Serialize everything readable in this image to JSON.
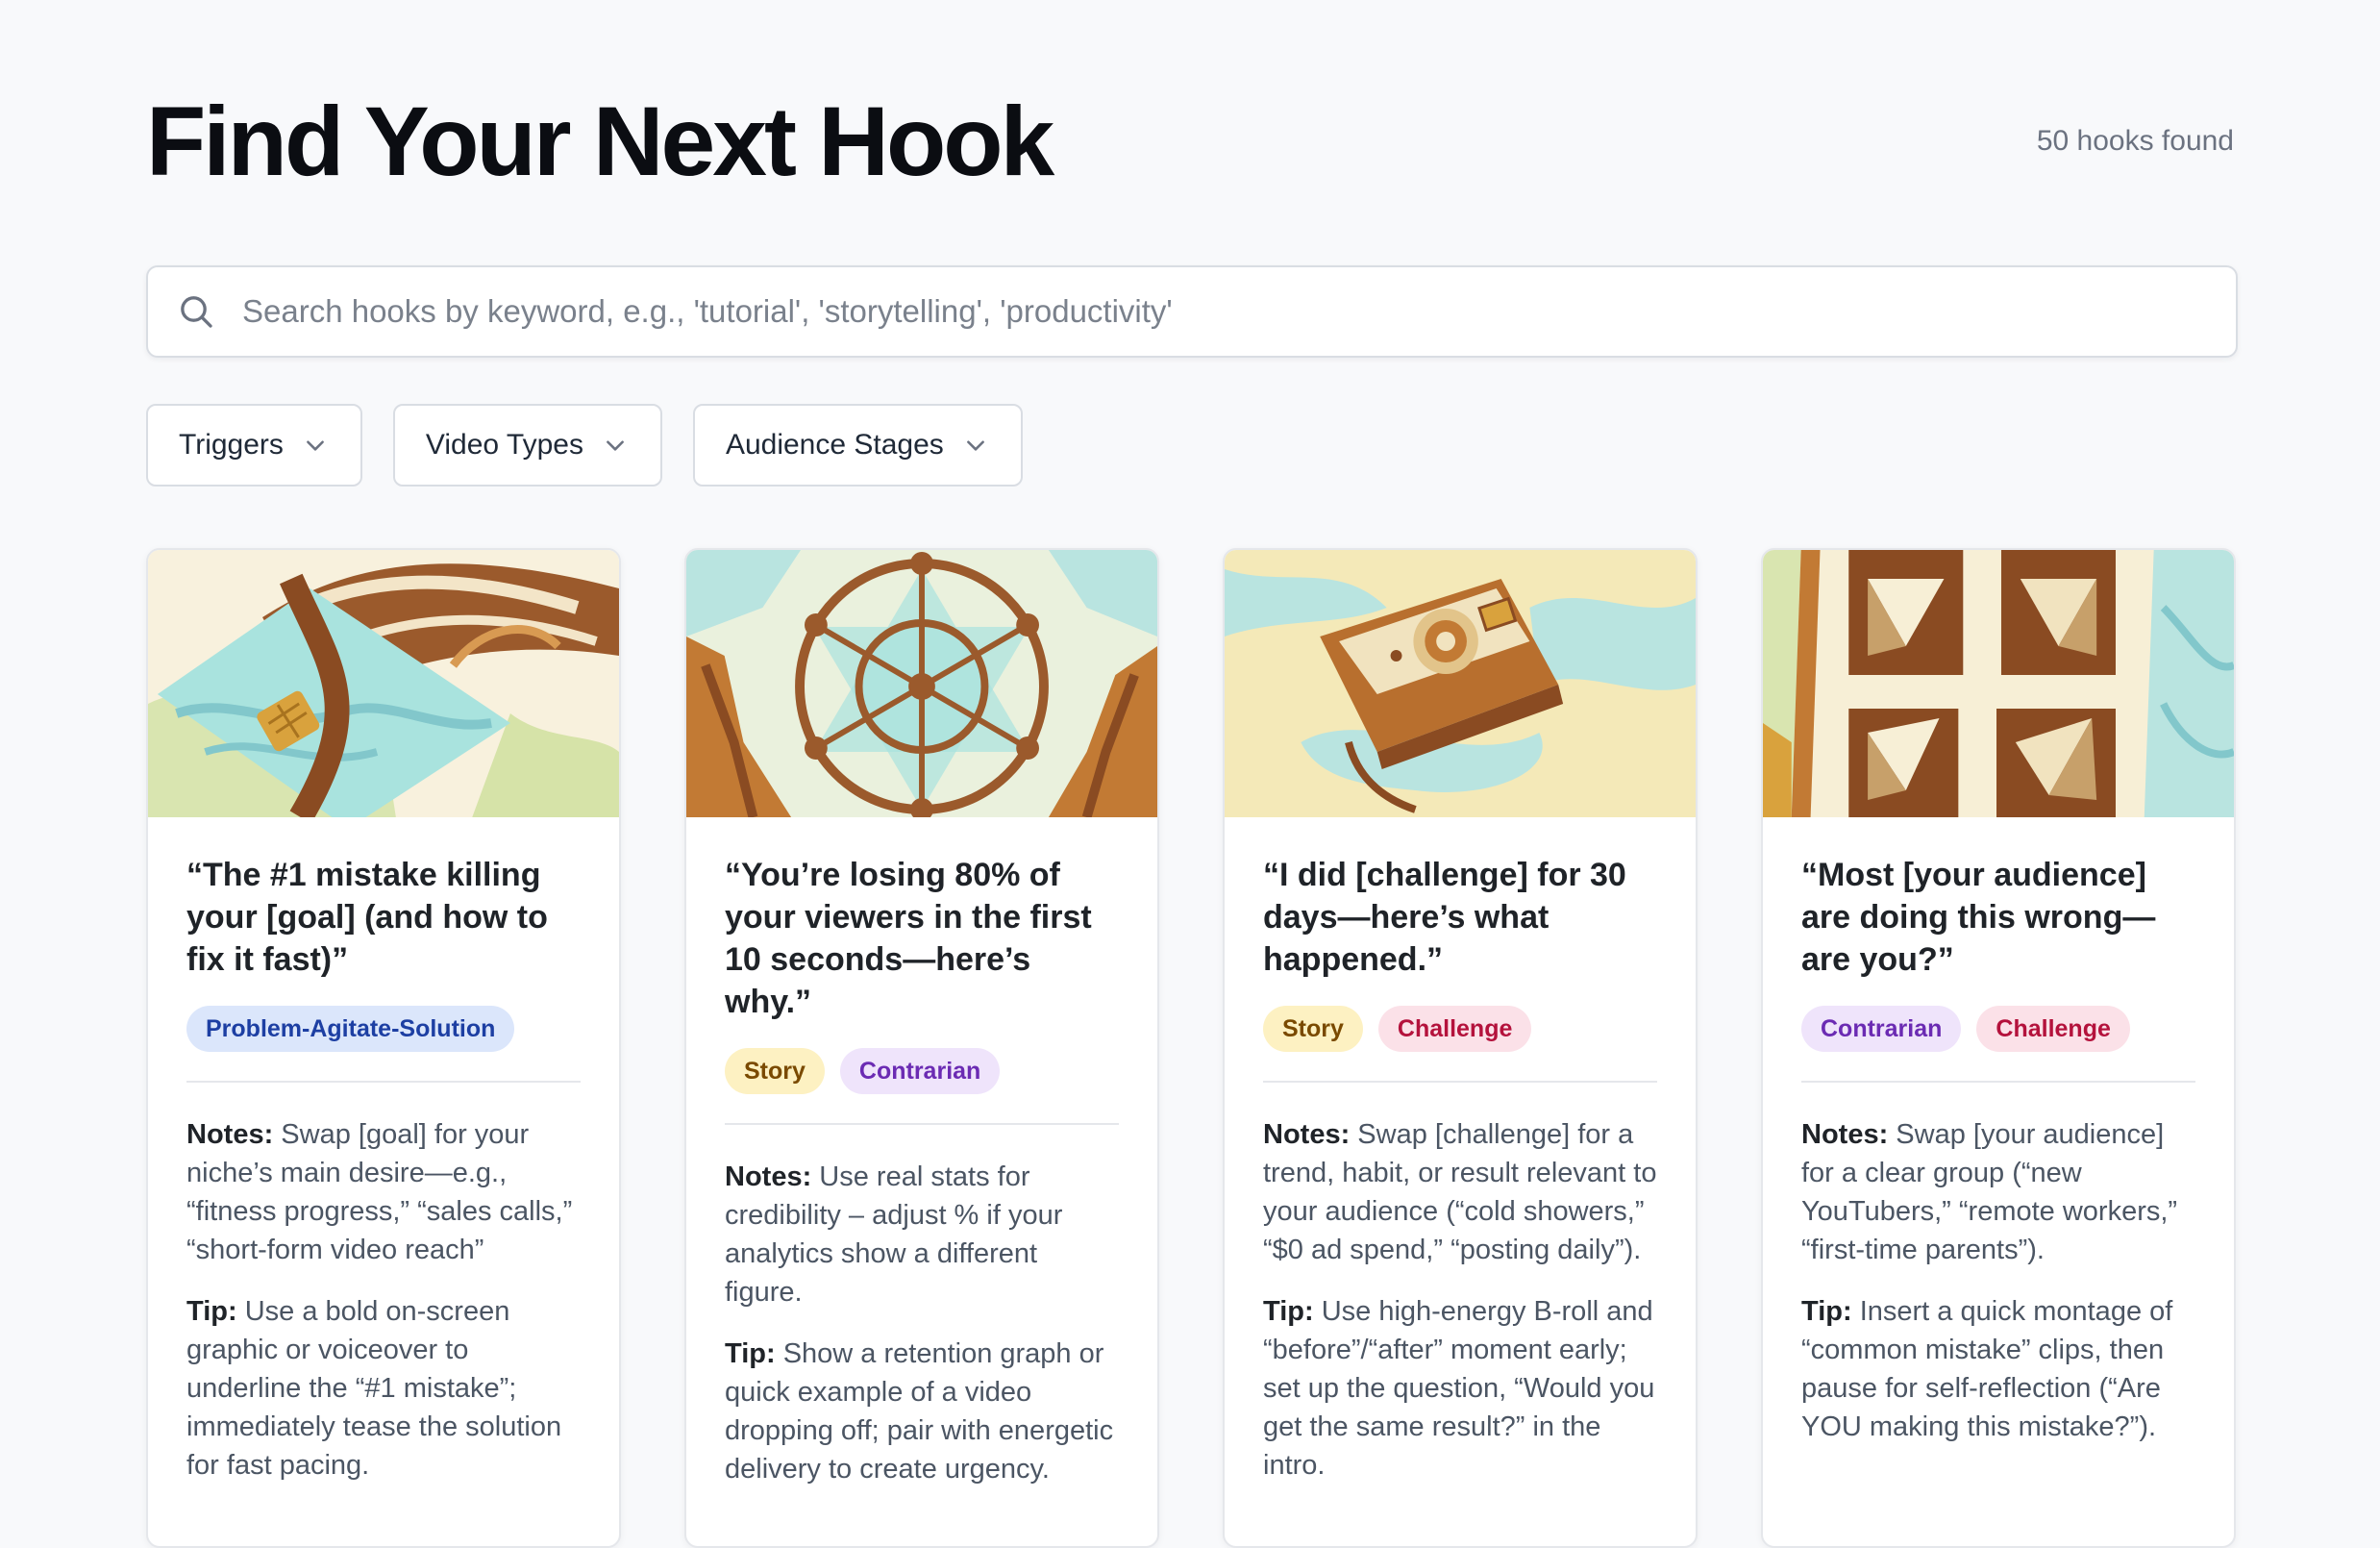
{
  "header": {
    "title": "Find Your Next Hook",
    "count_text": "50 hooks found"
  },
  "search": {
    "placeholder": "Search hooks by keyword, e.g., 'tutorial', 'storytelling', 'productivity'",
    "value": "",
    "icon": "search-icon"
  },
  "filters": [
    {
      "label": "Triggers",
      "icon": "chevron-down-icon"
    },
    {
      "label": "Video Types",
      "icon": "chevron-down-icon"
    },
    {
      "label": "Audience Stages",
      "icon": "chevron-down-icon"
    }
  ],
  "labels": {
    "notes": "Notes:",
    "tip": "Tip:"
  },
  "cards": [
    {
      "image": "credit-card-illustration",
      "hook": "“The #1 mistake killing your [goal] (and how to fix it fast)”",
      "tags": [
        {
          "label": "Problem-Agitate-Solution",
          "color": "#1d3fa3"
        }
      ],
      "notes": "Swap [goal] for your niche’s main desire—e.g., “fitness progress,” “sales calls,” “short-form video reach”",
      "tip": "Use a bold on-screen graphic or voiceover to underline the “#1 mistake”; immediately tease the solution for fast pacing."
    },
    {
      "image": "ship-wheel-illustration",
      "hook": "“You’re losing 80% of your viewers in the first 10 seconds—here’s why.”",
      "tags": [
        {
          "label": "Story",
          "color": "#7a4a00"
        },
        {
          "label": "Contrarian",
          "color": "#6b2bb3"
        }
      ],
      "notes": "Use real stats for credibility – adjust % if your analytics show a different figure.",
      "tip": "Show a retention graph or quick example of a video dropping off; pair with energetic delivery to create urgency."
    },
    {
      "image": "instant-camera-illustration",
      "hook": "“I did [challenge] for 30 days—here’s what happened.”",
      "tags": [
        {
          "label": "Story",
          "color": "#7a4a00"
        },
        {
          "label": "Challenge",
          "color": "#b4123c"
        }
      ],
      "notes": "Swap [challenge] for a trend, habit, or result relevant to your audience (“cold showers,” “$0 ad spend,” “posting daily”).",
      "tip": "Use high-energy B-roll and “before”/“after” moment early; set up the question, “Would you get the same result?” in the intro."
    },
    {
      "image": "studded-tiles-illustration",
      "hook": "“Most [your audience] are doing this wrong—are you?”",
      "tags": [
        {
          "label": "Contrarian",
          "color": "#6b2bb3"
        },
        {
          "label": "Challenge",
          "color": "#b4123c"
        }
      ],
      "notes": "Swap [your audience] for a clear group (“new YouTubers,” “remote workers,” “first-time parents”).",
      "tip": "Insert a quick montage of “common mistake” clips, then pause for self-reflection (“Are YOU making this mistake?”)."
    }
  ]
}
